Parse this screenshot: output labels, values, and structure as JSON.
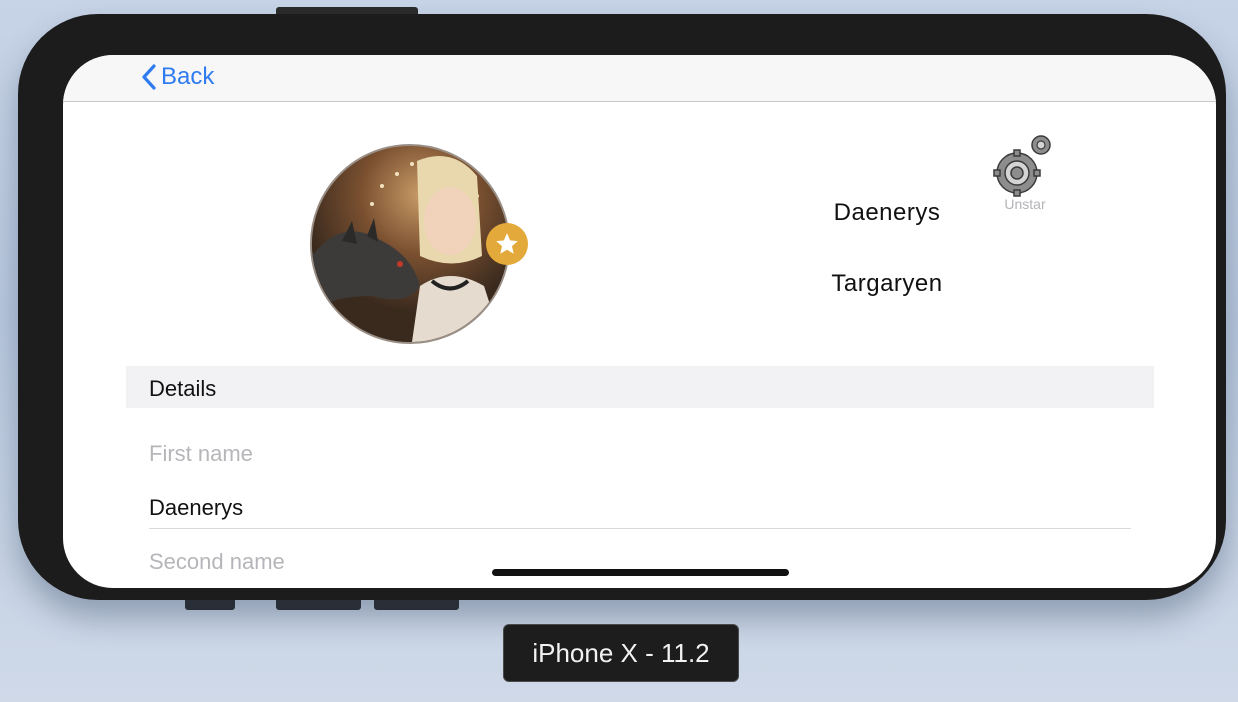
{
  "nav": {
    "back_label": "Back"
  },
  "profile": {
    "first_name": "Daenerys",
    "last_name": "Targaryen",
    "starred": true
  },
  "settings": {
    "label": "Unstar"
  },
  "details": {
    "header": "Details",
    "fields": [
      {
        "label": "First name",
        "value": "Daenerys"
      },
      {
        "label": "Second name"
      }
    ]
  },
  "device": {
    "label": "iPhone X - 11.2"
  },
  "colors": {
    "accent": "#2f7bf0",
    "star_badge": "#e3a93a"
  },
  "icons": [
    "chevron-left-icon",
    "star-icon",
    "gears-icon"
  ]
}
